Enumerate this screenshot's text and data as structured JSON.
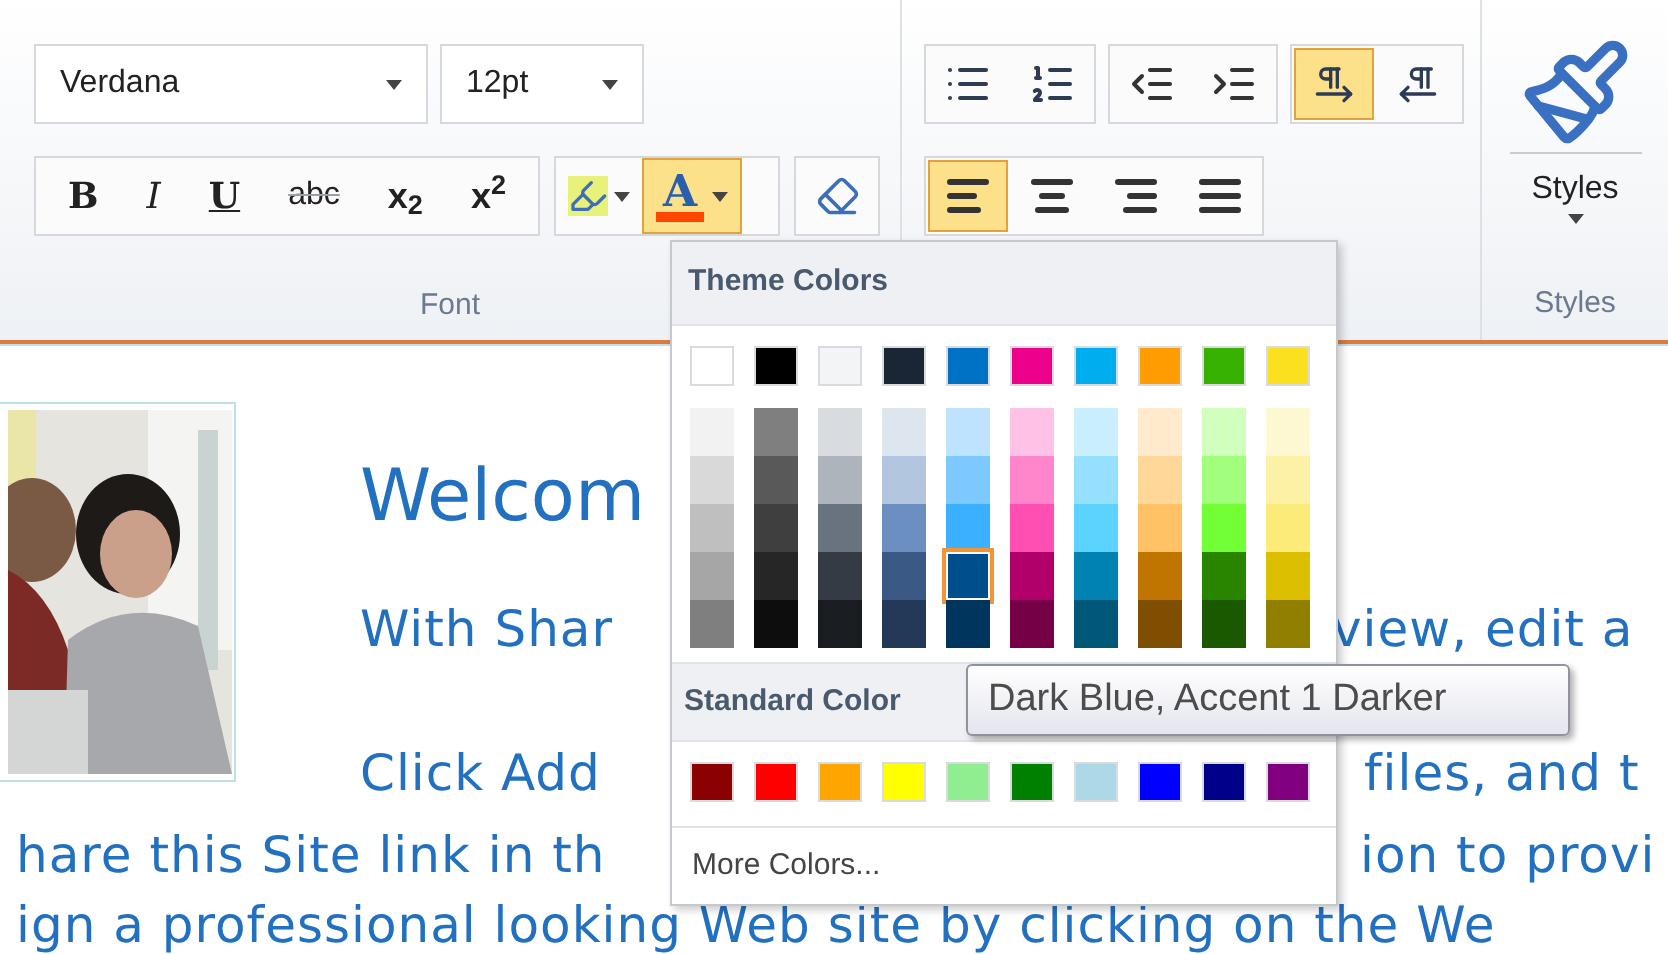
{
  "ribbon": {
    "font_group": {
      "font_name": "Verdana",
      "font_size": "12pt",
      "format_buttons": [
        {
          "kind": "bold",
          "label": "B"
        },
        {
          "kind": "italic",
          "label": "I"
        },
        {
          "kind": "underline",
          "label": "U"
        },
        {
          "kind": "strike",
          "label": "abc"
        },
        {
          "kind": "sub",
          "label": "x$_{2}$"
        },
        {
          "kind": "super",
          "label": "x$^{2}$"
        }
      ],
      "font_color": {
        "label": "A",
        "selected": true
      },
      "label": "Font"
    },
    "paragraph_group": {
      "direction_buttons": [
        {
          "kind": "ltr",
          "selected": true
        },
        {
          "kind": "rtl",
          "selected": false
        }
      ],
      "align_buttons": [
        {
          "kind": "left",
          "selected": true
        },
        {
          "kind": "center",
          "selected": false
        },
        {
          "kind": "right",
          "selected": false
        },
        {
          "kind": "justify",
          "selected": false
        }
      ]
    },
    "styles_group": {
      "button_label": "Styles",
      "label": "Styles"
    }
  },
  "page": {
    "heading": "Welcom",
    "lines": [
      {
        "left": "With Shar",
        "right": "view, edit a"
      },
      {
        "left": "Click Add",
        "right": "files, and t"
      },
      {
        "left": "hare this Site link in th",
        "right": "ion to provi"
      },
      {
        "left": "ign a professional looking Web site by clicking on the We"
      }
    ]
  },
  "color_menu": {
    "theme_title": "Theme Colors",
    "theme_colors": [
      {
        "color": "#ffffff",
        "selected": false,
        "shades": [
          {
            "color": "#f2f2f2",
            "selected": false
          },
          {
            "color": "#d9d9d9",
            "selected": false
          },
          {
            "color": "#bfbfbf",
            "selected": false
          },
          {
            "color": "#a6a6a6",
            "selected": false
          },
          {
            "color": "#7f7f7f",
            "selected": false
          }
        ]
      },
      {
        "color": "#000000",
        "selected": false,
        "shades": [
          {
            "color": "#7f7f7f",
            "selected": false
          },
          {
            "color": "#595959",
            "selected": false
          },
          {
            "color": "#3f3f3f",
            "selected": false
          },
          {
            "color": "#262626",
            "selected": false
          },
          {
            "color": "#0d0d0d",
            "selected": false
          }
        ]
      },
      {
        "color": "#f3f4f6",
        "selected": false,
        "shades": [
          {
            "color": "#d8dbdf",
            "selected": false
          },
          {
            "color": "#adb4bc",
            "selected": false
          },
          {
            "color": "#68737f",
            "selected": false
          },
          {
            "color": "#353b44",
            "selected": false
          },
          {
            "color": "#1a1e22",
            "selected": false
          }
        ]
      },
      {
        "color": "#1a2536",
        "selected": false,
        "shades": [
          {
            "color": "#dde5ef",
            "selected": false
          },
          {
            "color": "#b3c6df",
            "selected": false
          },
          {
            "color": "#6a8fc0",
            "selected": false
          },
          {
            "color": "#3a5a85",
            "selected": false
          },
          {
            "color": "#233957",
            "selected": false
          }
        ]
      },
      {
        "color": "#0072c6",
        "selected": false,
        "shades": [
          {
            "color": "#bde3ff",
            "selected": false
          },
          {
            "color": "#7dc8ff",
            "selected": false
          },
          {
            "color": "#3bb0ff",
            "selected": false
          },
          {
            "color": "#004f8c",
            "selected": true
          },
          {
            "color": "#00365e",
            "selected": false
          }
        ]
      },
      {
        "color": "#ec008c",
        "selected": false,
        "shades": [
          {
            "color": "#ffc1e5",
            "selected": false
          },
          {
            "color": "#ff86cb",
            "selected": false
          },
          {
            "color": "#ff4fb3",
            "selected": false
          },
          {
            "color": "#b1006a",
            "selected": false
          },
          {
            "color": "#760046",
            "selected": false
          }
        ]
      },
      {
        "color": "#00aeef",
        "selected": false,
        "shades": [
          {
            "color": "#c9efff",
            "selected": false
          },
          {
            "color": "#95e0ff",
            "selected": false
          },
          {
            "color": "#5cd2ff",
            "selected": false
          },
          {
            "color": "#0082b3",
            "selected": false
          },
          {
            "color": "#005777",
            "selected": false
          }
        ]
      },
      {
        "color": "#ff9d00",
        "selected": false,
        "shades": [
          {
            "color": "#ffebcb",
            "selected": false
          },
          {
            "color": "#ffd799",
            "selected": false
          },
          {
            "color": "#ffc264",
            "selected": false
          },
          {
            "color": "#bf7500",
            "selected": false
          },
          {
            "color": "#7f4e00",
            "selected": false
          }
        ]
      },
      {
        "color": "#37b200",
        "selected": false,
        "shades": [
          {
            "color": "#d1ffbd",
            "selected": false
          },
          {
            "color": "#a2ff7b",
            "selected": false
          },
          {
            "color": "#72ff35",
            "selected": false
          },
          {
            "color": "#298500",
            "selected": false
          },
          {
            "color": "#1b5900",
            "selected": false
          }
        ]
      },
      {
        "color": "#fbe020",
        "selected": false,
        "shades": [
          {
            "color": "#fef8d2",
            "selected": false
          },
          {
            "color": "#fdf1a5",
            "selected": false
          },
          {
            "color": "#fceb78",
            "selected": false
          },
          {
            "color": "#dcbf00",
            "selected": false
          },
          {
            "color": "#917f00",
            "selected": false
          }
        ]
      }
    ],
    "standard_title": "Standard Color",
    "standard_colors": [
      {
        "color": "#8b0000",
        "selected": false
      },
      {
        "color": "#ff0000",
        "selected": false
      },
      {
        "color": "#ffa500",
        "selected": false
      },
      {
        "color": "#ffff00",
        "selected": false
      },
      {
        "color": "#90ee90",
        "selected": false
      },
      {
        "color": "#008000",
        "selected": false
      },
      {
        "color": "#add8e6",
        "selected": false
      },
      {
        "color": "#0000ff",
        "selected": false
      },
      {
        "color": "#00008b",
        "selected": false
      },
      {
        "color": "#800080",
        "selected": false
      }
    ],
    "more_colors": "More Colors..."
  },
  "tooltip": "Dark Blue, Accent 1 Darker"
}
